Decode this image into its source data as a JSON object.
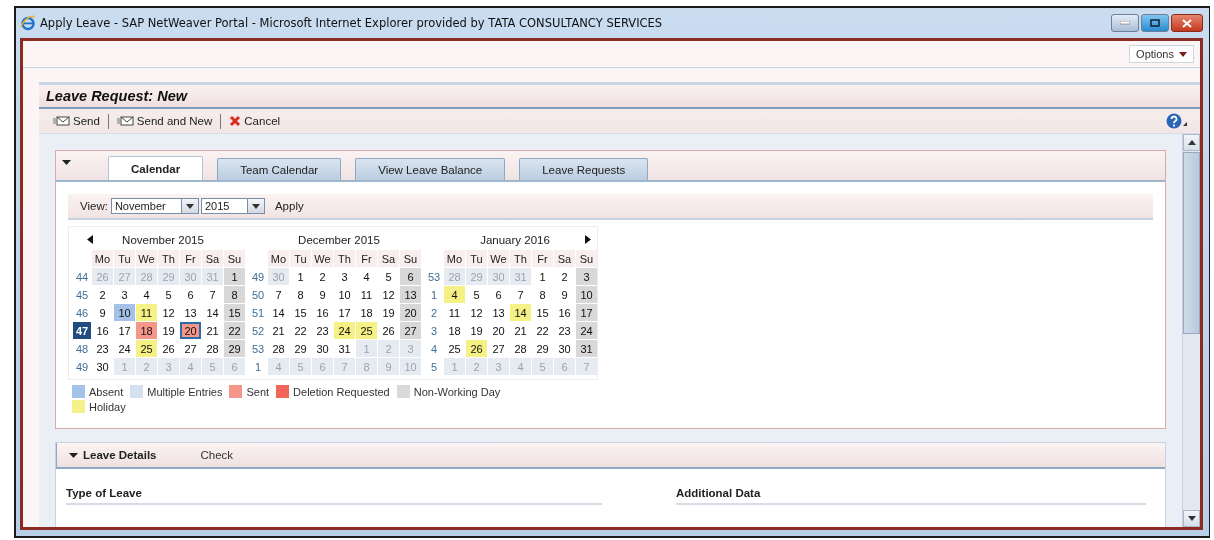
{
  "window": {
    "title": "Apply Leave - SAP NetWeaver Portal - Microsoft Internet Explorer provided by TATA CONSULTANCY SERVICES"
  },
  "options_button": "Options",
  "page_title": "Leave Request: New",
  "toolbar": [
    {
      "label": "Send",
      "kind": "send"
    },
    {
      "label": "Send and New",
      "kind": "send"
    },
    {
      "label": "Cancel",
      "kind": "cancel"
    }
  ],
  "tabs": [
    {
      "label": "Calendar",
      "selected": true
    },
    {
      "label": "Team Calendar",
      "selected": false
    },
    {
      "label": "View Leave Balance",
      "selected": false
    },
    {
      "label": "Leave Requests",
      "selected": false
    }
  ],
  "view": {
    "label": "View:",
    "month": "November",
    "year": "2015",
    "apply": "Apply"
  },
  "months": [
    {
      "title": "November 2015",
      "prev_arrow": true,
      "next_arrow": false,
      "weekdays": [
        "Mo",
        "Tu",
        "We",
        "Th",
        "Fr",
        "Sa",
        "Su"
      ],
      "weeks": [
        {
          "week": "44",
          "selected": false,
          "days": [
            {
              "d": "26",
              "kind": "outside",
              "selected": false
            },
            {
              "d": "27",
              "kind": "outside",
              "selected": false
            },
            {
              "d": "28",
              "kind": "outside",
              "selected": false
            },
            {
              "d": "29",
              "kind": "outside",
              "selected": false
            },
            {
              "d": "30",
              "kind": "outside",
              "selected": false
            },
            {
              "d": "31",
              "kind": "outside",
              "selected": false
            },
            {
              "d": "1",
              "kind": "off",
              "selected": false
            }
          ]
        },
        {
          "week": "45",
          "selected": false,
          "days": [
            {
              "d": "2",
              "kind": "work",
              "selected": false
            },
            {
              "d": "3",
              "kind": "work",
              "selected": false
            },
            {
              "d": "4",
              "kind": "work",
              "selected": false
            },
            {
              "d": "5",
              "kind": "work",
              "selected": false
            },
            {
              "d": "6",
              "kind": "work",
              "selected": false
            },
            {
              "d": "7",
              "kind": "work",
              "selected": false
            },
            {
              "d": "8",
              "kind": "off",
              "selected": false
            }
          ]
        },
        {
          "week": "46",
          "selected": false,
          "days": [
            {
              "d": "9",
              "kind": "work",
              "selected": false
            },
            {
              "d": "10",
              "kind": "absent",
              "selected": false
            },
            {
              "d": "11",
              "kind": "holiday",
              "selected": false
            },
            {
              "d": "12",
              "kind": "work",
              "selected": false
            },
            {
              "d": "13",
              "kind": "work",
              "selected": false
            },
            {
              "d": "14",
              "kind": "work",
              "selected": false
            },
            {
              "d": "15",
              "kind": "off",
              "selected": false
            }
          ]
        },
        {
          "week": "47",
          "selected": true,
          "days": [
            {
              "d": "16",
              "kind": "work",
              "selected": false
            },
            {
              "d": "17",
              "kind": "work",
              "selected": false
            },
            {
              "d": "18",
              "kind": "sent",
              "selected": false
            },
            {
              "d": "19",
              "kind": "work",
              "selected": false
            },
            {
              "d": "20",
              "kind": "sent",
              "selected": true
            },
            {
              "d": "21",
              "kind": "work",
              "selected": false
            },
            {
              "d": "22",
              "kind": "off",
              "selected": false
            }
          ]
        },
        {
          "week": "48",
          "selected": false,
          "days": [
            {
              "d": "23",
              "kind": "work",
              "selected": false
            },
            {
              "d": "24",
              "kind": "work",
              "selected": false
            },
            {
              "d": "25",
              "kind": "holiday",
              "selected": false
            },
            {
              "d": "26",
              "kind": "work",
              "selected": false
            },
            {
              "d": "27",
              "kind": "work",
              "selected": false
            },
            {
              "d": "28",
              "kind": "work",
              "selected": false
            },
            {
              "d": "29",
              "kind": "off",
              "selected": false
            }
          ]
        },
        {
          "week": "49",
          "selected": false,
          "days": [
            {
              "d": "30",
              "kind": "work",
              "selected": false
            },
            {
              "d": "1",
              "kind": "outside",
              "selected": false
            },
            {
              "d": "2",
              "kind": "outside",
              "selected": false
            },
            {
              "d": "3",
              "kind": "outside",
              "selected": false
            },
            {
              "d": "4",
              "kind": "outside",
              "selected": false
            },
            {
              "d": "5",
              "kind": "outside",
              "selected": false
            },
            {
              "d": "6",
              "kind": "outside",
              "selected": false
            }
          ]
        }
      ]
    },
    {
      "title": "December 2015",
      "prev_arrow": false,
      "next_arrow": false,
      "weekdays": [
        "Mo",
        "Tu",
        "We",
        "Th",
        "Fr",
        "Sa",
        "Su"
      ],
      "weeks": [
        {
          "week": "49",
          "selected": false,
          "days": [
            {
              "d": "30",
              "kind": "outside",
              "selected": false
            },
            {
              "d": "1",
              "kind": "work",
              "selected": false
            },
            {
              "d": "2",
              "kind": "work",
              "selected": false
            },
            {
              "d": "3",
              "kind": "work",
              "selected": false
            },
            {
              "d": "4",
              "kind": "work",
              "selected": false
            },
            {
              "d": "5",
              "kind": "work",
              "selected": false
            },
            {
              "d": "6",
              "kind": "off",
              "selected": false
            }
          ]
        },
        {
          "week": "50",
          "selected": false,
          "days": [
            {
              "d": "7",
              "kind": "work",
              "selected": false
            },
            {
              "d": "8",
              "kind": "work",
              "selected": false
            },
            {
              "d": "9",
              "kind": "work",
              "selected": false
            },
            {
              "d": "10",
              "kind": "work",
              "selected": false
            },
            {
              "d": "11",
              "kind": "work",
              "selected": false
            },
            {
              "d": "12",
              "kind": "work",
              "selected": false
            },
            {
              "d": "13",
              "kind": "off",
              "selected": false
            }
          ]
        },
        {
          "week": "51",
          "selected": false,
          "days": [
            {
              "d": "14",
              "kind": "work",
              "selected": false
            },
            {
              "d": "15",
              "kind": "work",
              "selected": false
            },
            {
              "d": "16",
              "kind": "work",
              "selected": false
            },
            {
              "d": "17",
              "kind": "work",
              "selected": false
            },
            {
              "d": "18",
              "kind": "work",
              "selected": false
            },
            {
              "d": "19",
              "kind": "work",
              "selected": false
            },
            {
              "d": "20",
              "kind": "off",
              "selected": false
            }
          ]
        },
        {
          "week": "52",
          "selected": false,
          "days": [
            {
              "d": "21",
              "kind": "work",
              "selected": false
            },
            {
              "d": "22",
              "kind": "work",
              "selected": false
            },
            {
              "d": "23",
              "kind": "work",
              "selected": false
            },
            {
              "d": "24",
              "kind": "holiday",
              "selected": false
            },
            {
              "d": "25",
              "kind": "holiday",
              "selected": false
            },
            {
              "d": "26",
              "kind": "work",
              "selected": false
            },
            {
              "d": "27",
              "kind": "off",
              "selected": false
            }
          ]
        },
        {
          "week": "53",
          "selected": false,
          "days": [
            {
              "d": "28",
              "kind": "work",
              "selected": false
            },
            {
              "d": "29",
              "kind": "work",
              "selected": false
            },
            {
              "d": "30",
              "kind": "work",
              "selected": false
            },
            {
              "d": "31",
              "kind": "work",
              "selected": false
            },
            {
              "d": "1",
              "kind": "outside",
              "selected": false
            },
            {
              "d": "2",
              "kind": "outside",
              "selected": false
            },
            {
              "d": "3",
              "kind": "outside",
              "selected": false
            }
          ]
        },
        {
          "week": "1",
          "selected": false,
          "days": [
            {
              "d": "4",
              "kind": "outside",
              "selected": false
            },
            {
              "d": "5",
              "kind": "outside",
              "selected": false
            },
            {
              "d": "6",
              "kind": "outside",
              "selected": false
            },
            {
              "d": "7",
              "kind": "outside",
              "selected": false
            },
            {
              "d": "8",
              "kind": "outside",
              "selected": false
            },
            {
              "d": "9",
              "kind": "outside",
              "selected": false
            },
            {
              "d": "10",
              "kind": "outside",
              "selected": false
            }
          ]
        }
      ]
    },
    {
      "title": "January 2016",
      "prev_arrow": false,
      "next_arrow": true,
      "weekdays": [
        "Mo",
        "Tu",
        "We",
        "Th",
        "Fr",
        "Sa",
        "Su"
      ],
      "weeks": [
        {
          "week": "53",
          "selected": false,
          "days": [
            {
              "d": "28",
              "kind": "outside",
              "selected": false
            },
            {
              "d": "29",
              "kind": "outside",
              "selected": false
            },
            {
              "d": "30",
              "kind": "outside",
              "selected": false
            },
            {
              "d": "31",
              "kind": "outside",
              "selected": false
            },
            {
              "d": "1",
              "kind": "work",
              "selected": false
            },
            {
              "d": "2",
              "kind": "work",
              "selected": false
            },
            {
              "d": "3",
              "kind": "off",
              "selected": false
            }
          ]
        },
        {
          "week": "1",
          "selected": false,
          "days": [
            {
              "d": "4",
              "kind": "holiday",
              "selected": false
            },
            {
              "d": "5",
              "kind": "work",
              "selected": false
            },
            {
              "d": "6",
              "kind": "work",
              "selected": false
            },
            {
              "d": "7",
              "kind": "work",
              "selected": false
            },
            {
              "d": "8",
              "kind": "work",
              "selected": false
            },
            {
              "d": "9",
              "kind": "work",
              "selected": false
            },
            {
              "d": "10",
              "kind": "off",
              "selected": false
            }
          ]
        },
        {
          "week": "2",
          "selected": false,
          "days": [
            {
              "d": "11",
              "kind": "work",
              "selected": false
            },
            {
              "d": "12",
              "kind": "work",
              "selected": false
            },
            {
              "d": "13",
              "kind": "work",
              "selected": false
            },
            {
              "d": "14",
              "kind": "holiday",
              "selected": false
            },
            {
              "d": "15",
              "kind": "work",
              "selected": false
            },
            {
              "d": "16",
              "kind": "work",
              "selected": false
            },
            {
              "d": "17",
              "kind": "off",
              "selected": false
            }
          ]
        },
        {
          "week": "3",
          "selected": false,
          "days": [
            {
              "d": "18",
              "kind": "work",
              "selected": false
            },
            {
              "d": "19",
              "kind": "work",
              "selected": false
            },
            {
              "d": "20",
              "kind": "work",
              "selected": false
            },
            {
              "d": "21",
              "kind": "work",
              "selected": false
            },
            {
              "d": "22",
              "kind": "work",
              "selected": false
            },
            {
              "d": "23",
              "kind": "work",
              "selected": false
            },
            {
              "d": "24",
              "kind": "off",
              "selected": false
            }
          ]
        },
        {
          "week": "4",
          "selected": false,
          "days": [
            {
              "d": "25",
              "kind": "work",
              "selected": false
            },
            {
              "d": "26",
              "kind": "holiday",
              "selected": false
            },
            {
              "d": "27",
              "kind": "work",
              "selected": false
            },
            {
              "d": "28",
              "kind": "work",
              "selected": false
            },
            {
              "d": "29",
              "kind": "work",
              "selected": false
            },
            {
              "d": "30",
              "kind": "work",
              "selected": false
            },
            {
              "d": "31",
              "kind": "off",
              "selected": false
            }
          ]
        },
        {
          "week": "5",
          "selected": false,
          "days": [
            {
              "d": "1",
              "kind": "outside",
              "selected": false
            },
            {
              "d": "2",
              "kind": "outside",
              "selected": false
            },
            {
              "d": "3",
              "kind": "outside",
              "selected": false
            },
            {
              "d": "4",
              "kind": "outside",
              "selected": false
            },
            {
              "d": "5",
              "kind": "outside",
              "selected": false
            },
            {
              "d": "6",
              "kind": "outside",
              "selected": false
            },
            {
              "d": "7",
              "kind": "outside",
              "selected": false
            }
          ]
        }
      ]
    }
  ],
  "legend": [
    {
      "label": "Absent",
      "color": "#a4c2e8"
    },
    {
      "label": "Multiple Entries",
      "color": "#d4e0ef"
    },
    {
      "label": "Sent",
      "color": "#f6968a"
    },
    {
      "label": "Deletion Requested",
      "color": "#f2665a"
    },
    {
      "label": "Non-Working Day",
      "color": "#d9d9d9"
    },
    {
      "label": "Holiday",
      "color": "#f4f08a"
    }
  ],
  "details": {
    "title": "Leave Details",
    "check": "Check",
    "type_of_leave": "Type of Leave",
    "additional_data": "Additional Data"
  }
}
